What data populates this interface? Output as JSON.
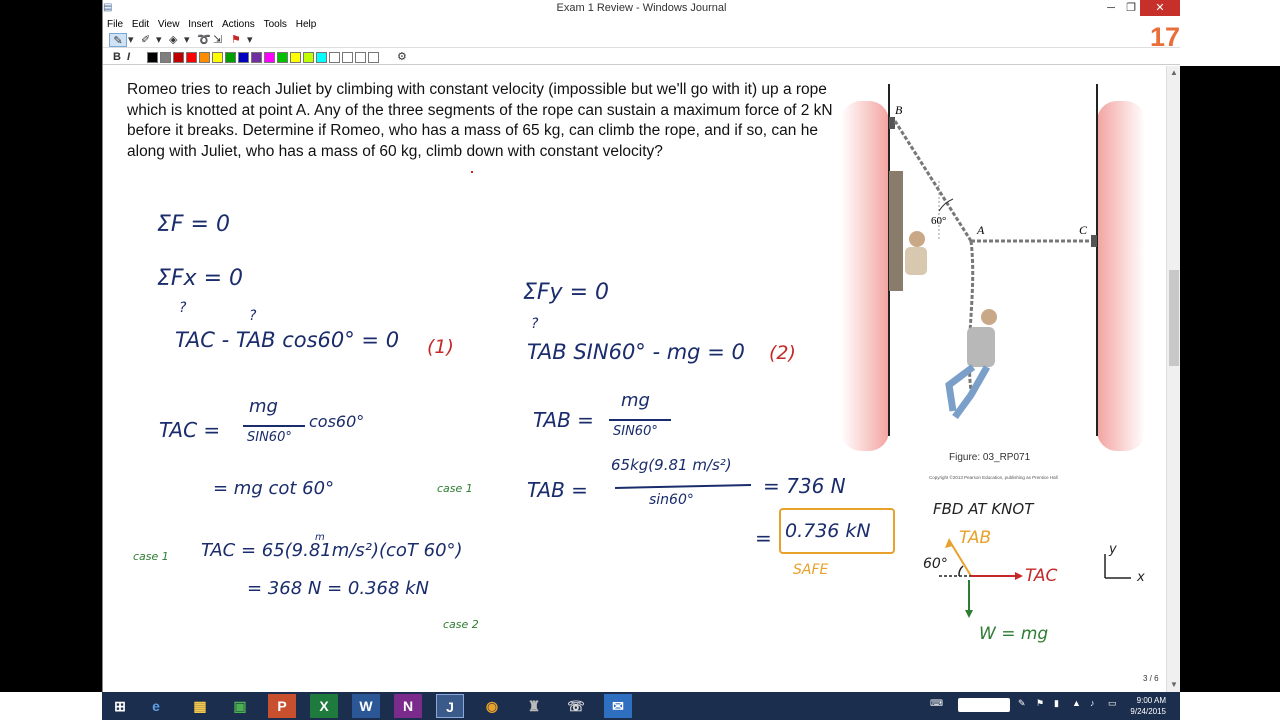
{
  "window": {
    "title": "Exam 1 Review - Windows Journal",
    "page_number": "17"
  },
  "menu": [
    "File",
    "Edit",
    "View",
    "Insert",
    "Actions",
    "Tools",
    "Help"
  ],
  "format": {
    "bold": "B",
    "italic": "I"
  },
  "palette": [
    "#000000",
    "#7f7f7f",
    "#c00000",
    "#ff0000",
    "#ff8c00",
    "#ffff00",
    "#00a000",
    "#0000c0",
    "#7030a0",
    "#ff00ff",
    "#00c000",
    "#ffff00",
    "#c0ff00",
    "#00ffff",
    "#ffffff",
    "#ffffff",
    "#ffffff",
    "#ffffff"
  ],
  "problem": {
    "text": "Romeo tries to reach Juliet by climbing with constant velocity (impossible but we'll go with it) up a rope which is knotted at point A.  Any of the three segments of the rope can sustain a maximum force of 2 kN before it breaks.  Determine if Romeo, who has a mass of 65 kg, can climb the rope, and if so, can he along with Juliet, who has a mass of 60 kg, climb down with constant velocity?"
  },
  "figure": {
    "caption": "Figure: 03_RP071",
    "copyright": "Copyright ©2013 Pearson Education, publishing as Prentice Hall",
    "label_b": "B",
    "label_a": "A",
    "label_c": "C",
    "angle": "60°"
  },
  "notes": {
    "sum_f": "ΣF = 0",
    "sum_fx": "ΣFx = 0",
    "sum_fy": "ΣFy = 0",
    "eq1": "TAC - TAB cos60° = 0",
    "eq1_num": "(1)",
    "eq2": "TAB SIN60° - mg = 0",
    "eq2_num": "(2)",
    "q1": "?",
    "q2": "?",
    "q3": "?",
    "tac_formula_lhs": "TAC =",
    "tac_formula_num": "mg",
    "tac_formula_den": "SIN60°",
    "tac_formula_rest": "cos60°",
    "tab_formula_lhs": "TAB =",
    "tab_formula_num": "mg",
    "tab_formula_den": "SIN60°",
    "tac_cot": "= mg cot 60°",
    "case1_a": "case 1",
    "case1_b": "case 1",
    "case2": "case 2",
    "tab_num_lhs": "TAB =",
    "tab_num_num": "65kg(9.81 m/s²)",
    "tab_num_den": "sin60°",
    "tab_num_result": "= 736 N",
    "tac_num": "TAC = 65(9.81m/s²)(coT 60°)",
    "tac_num_mark": "m",
    "tac_result": "= 368 N = 0.368 kN",
    "tab_kn_eq": "=",
    "tab_kn": "0.736 kN",
    "safe": "SAFE",
    "fbd_title": "FBD AT KNOT",
    "fbd_tab": "TAB",
    "fbd_tac": "TAC",
    "fbd_angle": "60°",
    "fbd_w": "W = mg",
    "axis_y": "y",
    "axis_x": "x"
  },
  "status": {
    "page_indicator": "3 / 6"
  },
  "taskbar": {
    "apps": [
      "e",
      "▦",
      "▣",
      "P",
      "X",
      "W",
      "N",
      "J",
      "◉",
      "♜",
      "☏",
      "✉"
    ],
    "clock_time": "9:00 AM",
    "clock_date": "9/24/2015"
  }
}
